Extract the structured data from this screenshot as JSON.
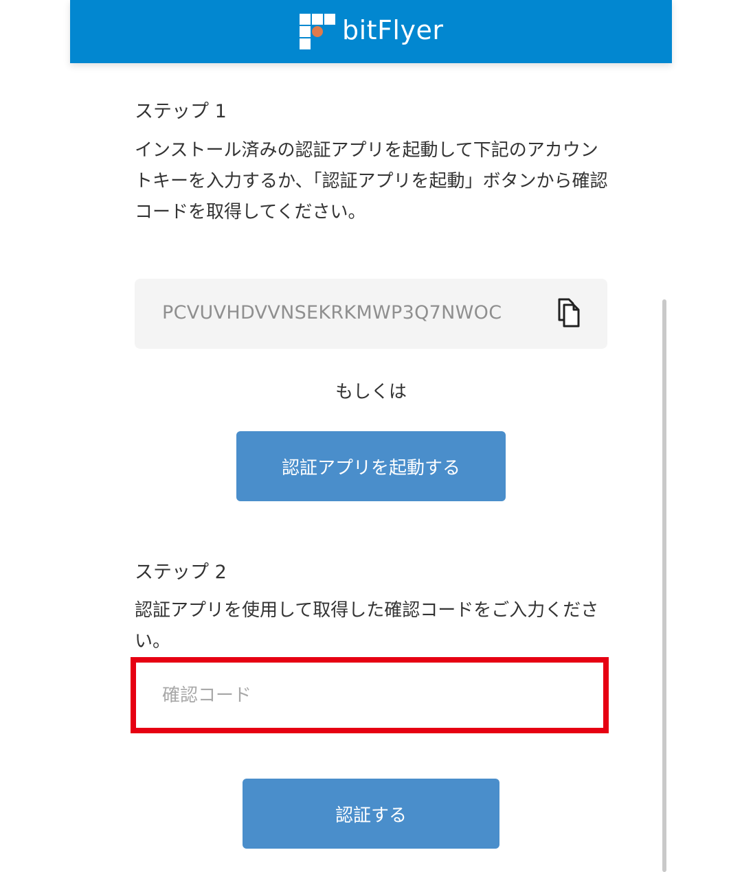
{
  "header": {
    "brand_name": "bitFlyer",
    "logo_accent_color": "#e07a4a",
    "background_color": "#0287d0"
  },
  "step1": {
    "title": "ステップ 1",
    "description": "インストール済みの認証アプリを起動して下記のアカウントキーを入力するか、「認証アプリを起動」ボタンから確認コードを取得してください。",
    "account_key": "PCVUVHDVVNSEKRKMWP3Q7NWOC",
    "copy_icon": "copy-icon",
    "or_text": "もしくは",
    "launch_button_label": "認証アプリを起動する"
  },
  "step2": {
    "title": "ステップ 2",
    "description": "認証アプリを使用して取得した確認コードをご入力ください。",
    "code_placeholder": "確認コード",
    "code_value": "",
    "highlight_color": "#e60012",
    "verify_button_label": "認証する"
  },
  "colors": {
    "button": "#4a8ecb",
    "keybox_bg": "#f4f4f4"
  }
}
